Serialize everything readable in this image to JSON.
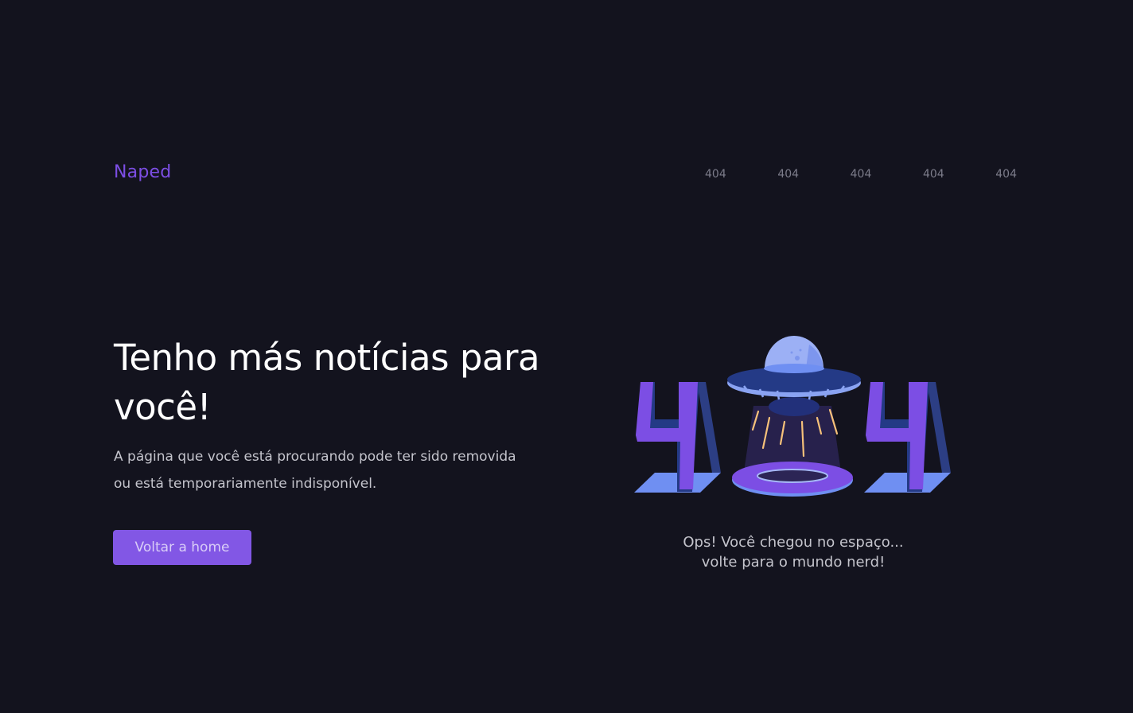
{
  "header": {
    "logo": "Naped",
    "nav": [
      "404",
      "404",
      "404",
      "404",
      "404"
    ]
  },
  "main": {
    "headline_line1": "Tenho más notícias para",
    "headline_line2": "você!",
    "description_line1": "A página que você está procurando pode ter sido removida",
    "description_line2": "ou está temporariamente indisponível.",
    "button_label": "Voltar a home"
  },
  "illustration": {
    "caption_line1": "Ops! Você chegou no espaço...",
    "caption_line2": "volte para o mundo nerd!"
  },
  "colors": {
    "background": "#13131e",
    "accent": "#8257e5",
    "text_primary": "#ffffff",
    "text_secondary": "#c4c4cc",
    "nav_text": "#7c7c8a"
  }
}
